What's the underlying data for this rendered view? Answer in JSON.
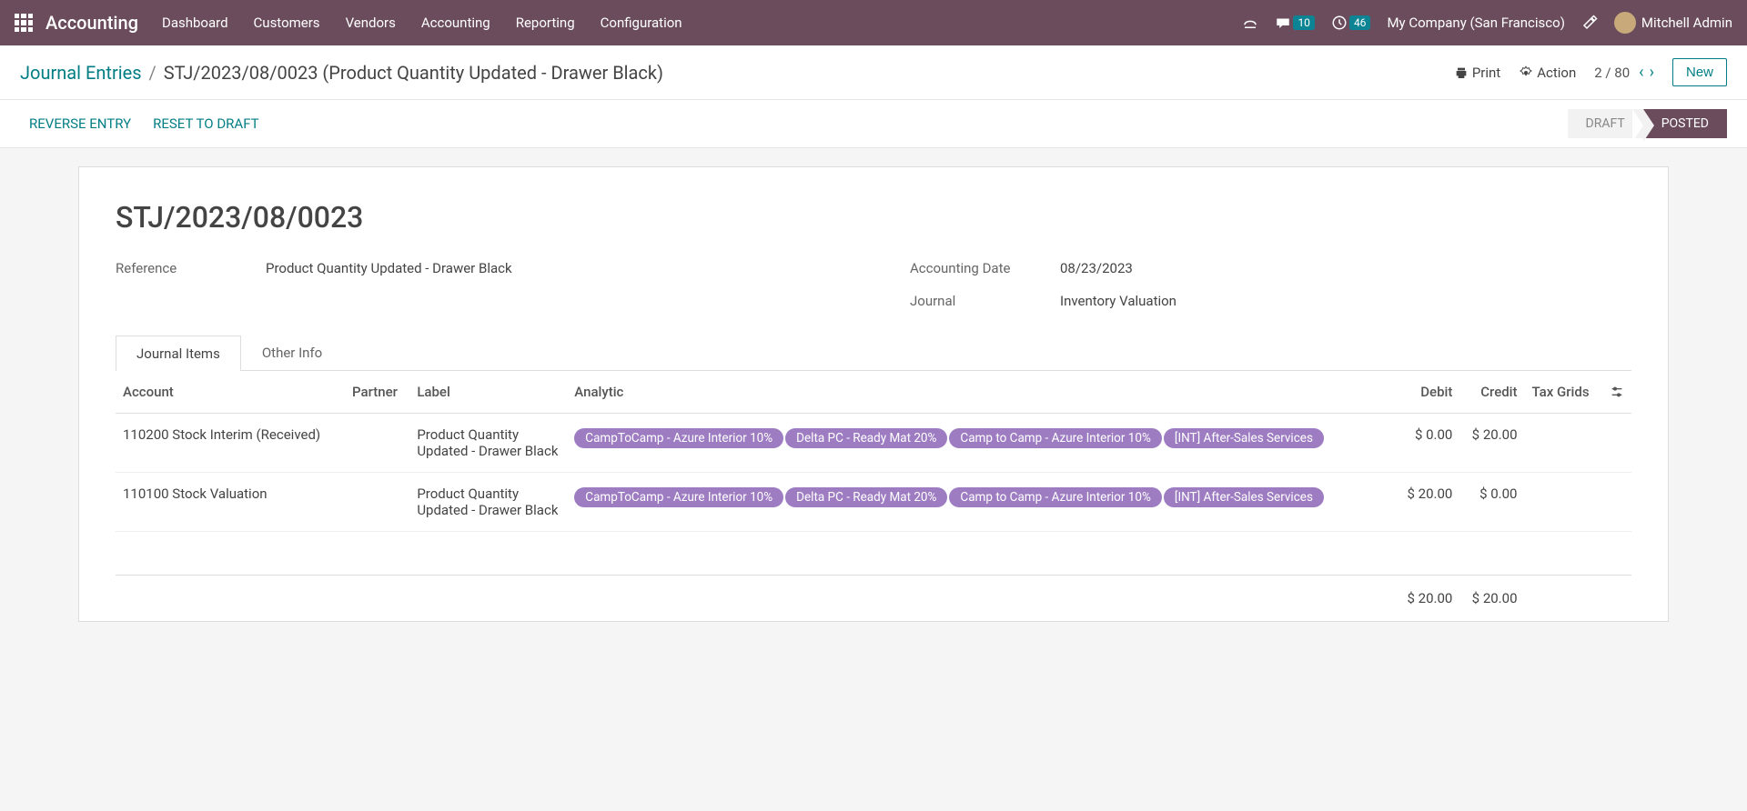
{
  "topbar": {
    "app_name": "Accounting",
    "nav": [
      "Dashboard",
      "Customers",
      "Vendors",
      "Accounting",
      "Reporting",
      "Configuration"
    ],
    "messages_badge": "10",
    "activities_badge": "46",
    "company": "My Company (San Francisco)",
    "user": "Mitchell Admin"
  },
  "subheader": {
    "breadcrumb_root": "Journal Entries",
    "breadcrumb_current": "STJ/2023/08/0023 (Product Quantity Updated - Drawer Black)",
    "print": "Print",
    "action": "Action",
    "pager": "2 / 80",
    "new": "New"
  },
  "statusbar": {
    "reverse": "REVERSE ENTRY",
    "reset": "RESET TO DRAFT",
    "draft": "DRAFT",
    "posted": "POSTED"
  },
  "record": {
    "title": "STJ/2023/08/0023",
    "fields": {
      "reference_label": "Reference",
      "reference_value": "Product Quantity Updated - Drawer Black",
      "date_label": "Accounting Date",
      "date_value": "08/23/2023",
      "journal_label": "Journal",
      "journal_value": "Inventory Valuation"
    },
    "tabs": {
      "items": "Journal Items",
      "other": "Other Info"
    },
    "columns": {
      "account": "Account",
      "partner": "Partner",
      "label": "Label",
      "analytic": "Analytic",
      "debit": "Debit",
      "credit": "Credit",
      "taxgrids": "Tax Grids"
    },
    "rows": [
      {
        "account": "110200 Stock Interim (Received)",
        "partner": "",
        "label": "Product Quantity Updated - Drawer Black",
        "tags": [
          "CampToCamp - Azure Interior 10%",
          "Delta PC - Ready Mat 20%",
          "Camp to Camp - Azure Interior 10%",
          "[INT] After-Sales Services"
        ],
        "debit": "$ 0.00",
        "credit": "$ 20.00"
      },
      {
        "account": "110100 Stock Valuation",
        "partner": "",
        "label": "Product Quantity Updated - Drawer Black",
        "tags": [
          "CampToCamp - Azure Interior 10%",
          "Delta PC - Ready Mat 20%",
          "Camp to Camp - Azure Interior 10%",
          "[INT] After-Sales Services"
        ],
        "debit": "$ 20.00",
        "credit": "$ 0.00"
      }
    ],
    "totals": {
      "debit": "$ 20.00",
      "credit": "$ 20.00"
    }
  }
}
